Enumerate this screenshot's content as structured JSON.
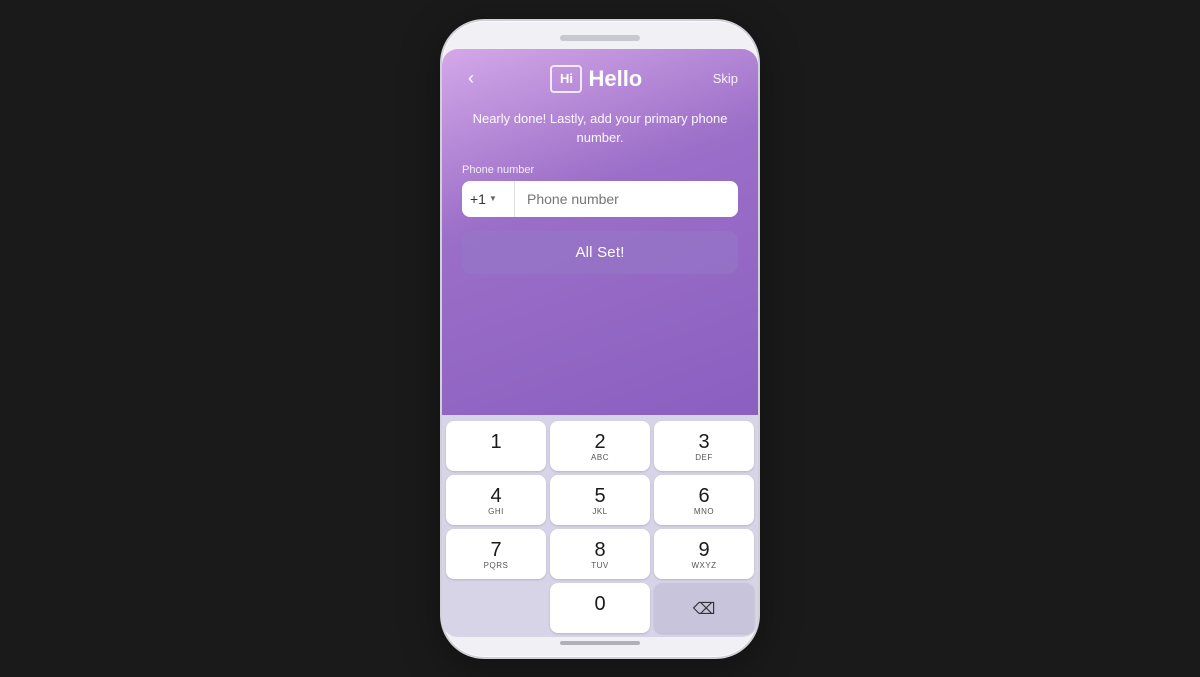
{
  "app": {
    "logo_text": "Hi",
    "name": "Hello",
    "back_label": "‹",
    "skip_label": "Skip"
  },
  "header": {
    "subtitle": "Nearly done! Lastly, add your primary phone number."
  },
  "phone_field": {
    "label": "Phone number",
    "country_code": "+1",
    "placeholder": "Phone number"
  },
  "buttons": {
    "all_set": "All Set!"
  },
  "keyboard": {
    "rows": [
      [
        {
          "number": "1",
          "letters": ""
        },
        {
          "number": "2",
          "letters": "ABC"
        },
        {
          "number": "3",
          "letters": "DEF"
        }
      ],
      [
        {
          "number": "4",
          "letters": "GHI"
        },
        {
          "number": "5",
          "letters": "JKL"
        },
        {
          "number": "6",
          "letters": "MNO"
        }
      ],
      [
        {
          "number": "7",
          "letters": "PQRS"
        },
        {
          "number": "8",
          "letters": "TUV"
        },
        {
          "number": "9",
          "letters": "WXYZ"
        }
      ],
      [
        {
          "number": "",
          "letters": "",
          "type": "empty"
        },
        {
          "number": "0",
          "letters": ""
        },
        {
          "number": "⌫",
          "letters": "",
          "type": "backspace"
        }
      ]
    ]
  },
  "colors": {
    "gradient_start": "#d4a8e8",
    "gradient_end": "#8b5fc0",
    "keyboard_bg": "#d8d4e8",
    "key_bg": "#ffffff",
    "special_key_bg": "#c8c4dc"
  }
}
